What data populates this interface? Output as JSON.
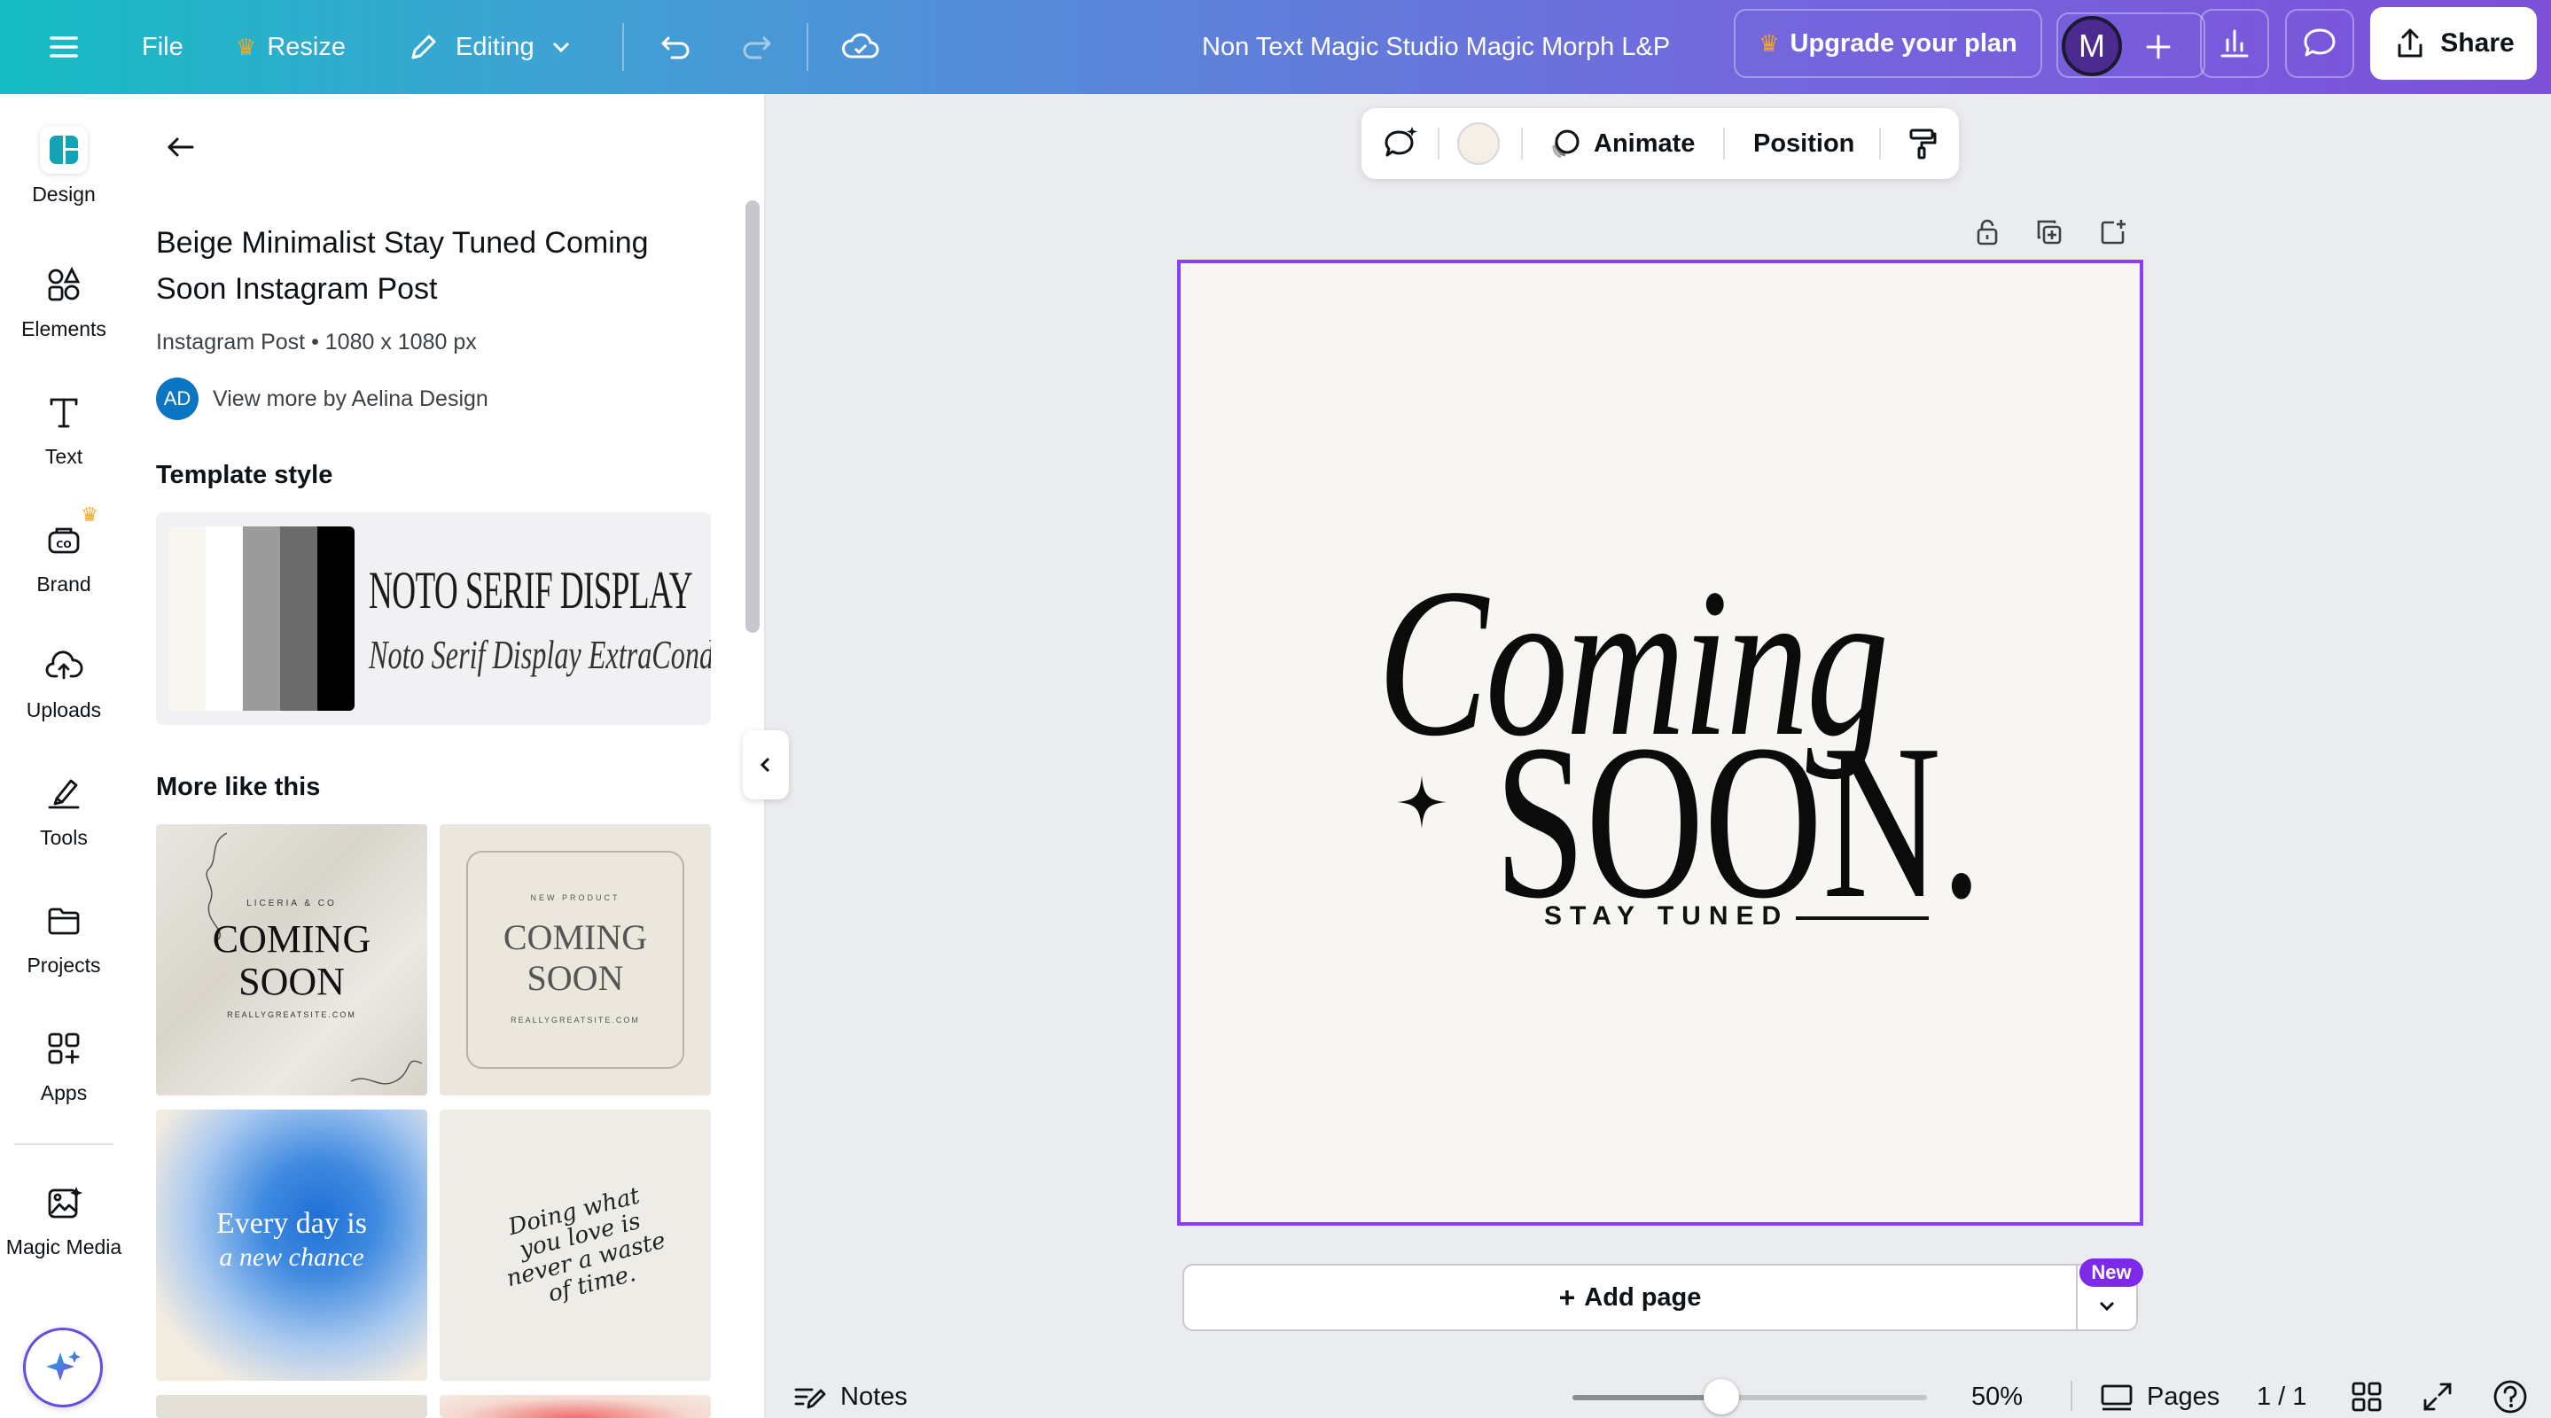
{
  "topbar": {
    "file_label": "File",
    "resize_label": "Resize",
    "editing_label": "Editing",
    "doc_title": "Non Text Magic Studio Magic Morph L&P",
    "upgrade_label": "Upgrade your plan",
    "avatar_initial": "M",
    "share_label": "Share",
    "crown_color": "#f5a623"
  },
  "rail": {
    "items": [
      {
        "label": "Design",
        "icon": "design-icon"
      },
      {
        "label": "Elements",
        "icon": "elements-icon"
      },
      {
        "label": "Text",
        "icon": "text-icon"
      },
      {
        "label": "Brand",
        "icon": "brand-icon"
      },
      {
        "label": "Uploads",
        "icon": "uploads-icon"
      },
      {
        "label": "Tools",
        "icon": "tools-icon"
      },
      {
        "label": "Projects",
        "icon": "folder-icon"
      },
      {
        "label": "Apps",
        "icon": "apps-icon"
      },
      {
        "label": "Magic Media",
        "icon": "magic-media-icon"
      }
    ]
  },
  "panel": {
    "title": "Beige Minimalist Stay Tuned Coming Soon Instagram Post",
    "meta": "Instagram Post • 1080 x 1080 px",
    "author_initials": "AD",
    "author_link": "View more by Aelina Design",
    "template_style_heading": "Template style",
    "font_heading": "NOTO SERIF DISPLAY",
    "font_body": "Noto Serif Display ExtraCondensed",
    "palette": [
      "#f8f6f0",
      "#ffffff",
      "#9b9b9b",
      "#6b6b6b",
      "#3f3f3f",
      "#000000"
    ],
    "more_like_heading": "More like this",
    "thumbs": [
      {
        "top_text": "LICERIA & CO",
        "main1": "COMING",
        "main2": "SOON",
        "bottom_text": "REALLYGREATSITE.COM"
      },
      {
        "top_text": "NEW PRODUCT",
        "main1": "COMING",
        "main2": "SOON",
        "bottom_text": "REALLYGREATSITE.COM"
      },
      {
        "main1": "Every day is",
        "main2": "a new chance"
      },
      {
        "line1": "Doing what",
        "line2": "you love is",
        "line3": "never a waste",
        "line4": "of time."
      }
    ]
  },
  "ctx_toolbar": {
    "animate_label": "Animate",
    "position_label": "Position",
    "color_swatch": "#f6efe6"
  },
  "design": {
    "coming": "Coming",
    "soon": "SOON.",
    "stay_tuned": "STAY TUNED",
    "bg_color": "#f8f6f2",
    "selection_color": "#8b3dff"
  },
  "add_page": {
    "label": "Add page",
    "new_badge": "New"
  },
  "bottombar": {
    "notes_label": "Notes",
    "zoom_label": "50%",
    "zoom_level": 0.42,
    "pages_label": "Pages",
    "page_count": "1 / 1"
  }
}
